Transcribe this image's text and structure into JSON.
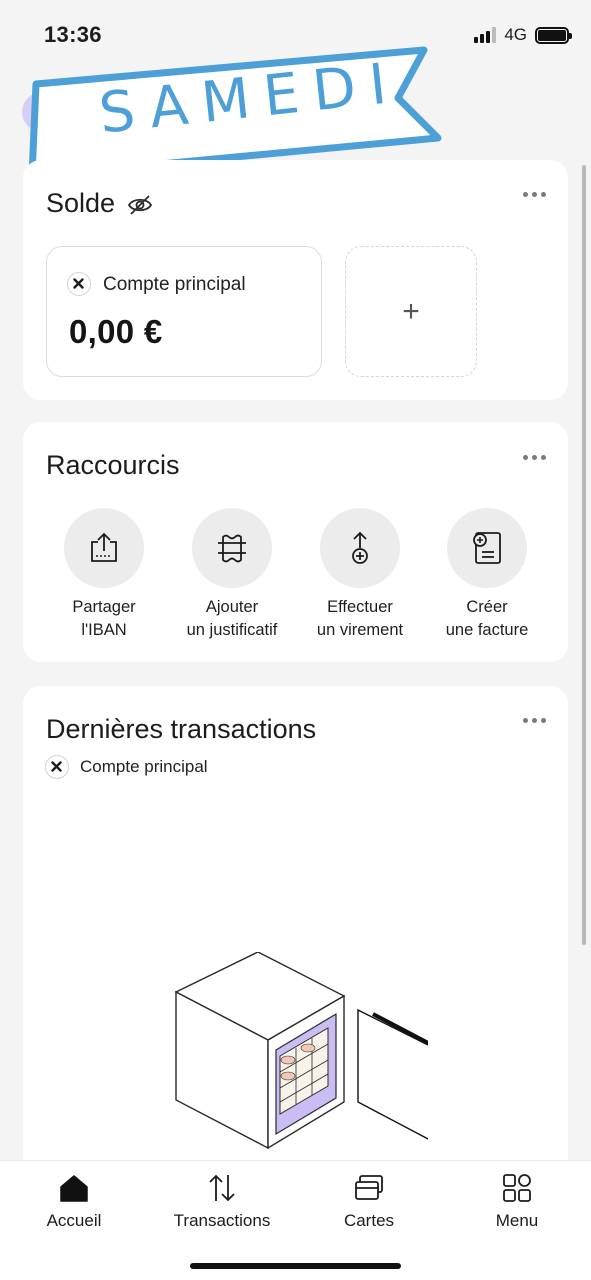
{
  "status_bar": {
    "time": "13:36",
    "network": "4G"
  },
  "header": {
    "banner_text": "SAMEDI"
  },
  "solde": {
    "title": "Solde",
    "account_name": "Compte principal",
    "amount": "0,00 €",
    "add_label": "+"
  },
  "raccourcis": {
    "title": "Raccourcis",
    "items": [
      {
        "line1": "Partager",
        "line2": "l'IBAN",
        "icon": "share-iban-icon"
      },
      {
        "line1": "Ajouter",
        "line2": "un justificatif",
        "icon": "receipt-icon"
      },
      {
        "line1": "Effectuer",
        "line2": "un virement",
        "icon": "transfer-icon"
      },
      {
        "line1": "Créer",
        "line2": "une facture",
        "icon": "invoice-icon"
      }
    ]
  },
  "transactions": {
    "title": "Dernières transactions",
    "account_name": "Compte principal",
    "illustration": "safe-illustration"
  },
  "nav": {
    "items": [
      {
        "label": "Accueil",
        "icon": "home-icon"
      },
      {
        "label": "Transactions",
        "icon": "transactions-arrows-icon"
      },
      {
        "label": "Cartes",
        "icon": "cards-icon"
      },
      {
        "label": "Menu",
        "icon": "menu-grid-icon"
      }
    ]
  },
  "colors": {
    "background": "#f4f4f4",
    "card": "#ffffff",
    "banner_blue": "#4d9fd8",
    "safe_purple": "#c9bdf3"
  }
}
